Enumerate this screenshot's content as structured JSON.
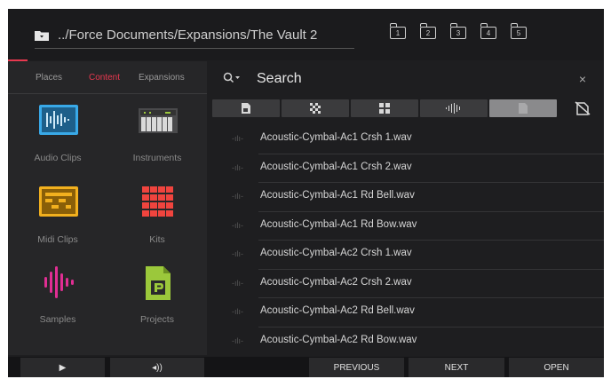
{
  "header": {
    "path": "../Force Documents/Expansions/The Vault 2",
    "slots": [
      "1",
      "2",
      "3",
      "4",
      "5"
    ]
  },
  "left_tabs": [
    {
      "label": "Places",
      "active": false
    },
    {
      "label": "Content",
      "active": true
    },
    {
      "label": "Expansions",
      "active": false
    }
  ],
  "tiles": [
    {
      "label": "Audio Clips",
      "icon": "audio-clips-icon"
    },
    {
      "label": "Instruments",
      "icon": "instruments-icon"
    },
    {
      "label": "Midi Clips",
      "icon": "midi-clips-icon"
    },
    {
      "label": "Kits",
      "icon": "kits-icon"
    },
    {
      "label": "Samples",
      "icon": "samples-icon"
    },
    {
      "label": "Projects",
      "icon": "projects-icon"
    }
  ],
  "search": {
    "label": "Search",
    "close": "×"
  },
  "filters": [
    "document-filter-icon",
    "pattern-filter-icon",
    "grid-filter-icon",
    "waveform-filter-icon",
    "sample-filter-icon",
    "hidden-filter-icon"
  ],
  "files": [
    "Acoustic-Cymbal-Ac1 Crsh 1.wav",
    "Acoustic-Cymbal-Ac1 Crsh 2.wav",
    "Acoustic-Cymbal-Ac1 Rd Bell.wav",
    "Acoustic-Cymbal-Ac1 Rd Bow.wav",
    "Acoustic-Cymbal-Ac2 Crsh 1.wav",
    "Acoustic-Cymbal-Ac2 Crsh 2.wav",
    "Acoustic-Cymbal-Ac2 Rd Bell.wav",
    "Acoustic-Cymbal-Ac2 Rd Bow.wav"
  ],
  "bottom": {
    "play": "▶",
    "volume": "◂))",
    "previous": "PREVIOUS",
    "next": "NEXT",
    "open": "OPEN"
  },
  "colors": {
    "accent": "#e8384f",
    "audio": "#39a9e8",
    "midi": "#f2b01e",
    "kits": "#f0443e",
    "samples": "#e02e93",
    "projects": "#9bc83b"
  }
}
